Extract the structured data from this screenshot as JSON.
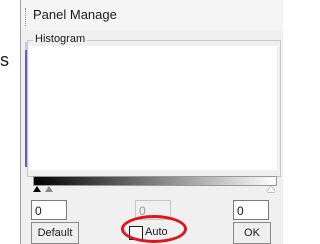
{
  "left_fragment": {
    "text": "s"
  },
  "panel": {
    "title": "Panel Manage",
    "histogram_label": "Histogram",
    "min_value": "0",
    "mid_value": "0",
    "max_value": "0",
    "auto_label": "Auto",
    "auto_checked": false,
    "default_button": "Default",
    "ok_button": "OK"
  },
  "colors": {
    "histogram_line": "#6a5acd",
    "highlight_oval": "#e0141a"
  }
}
